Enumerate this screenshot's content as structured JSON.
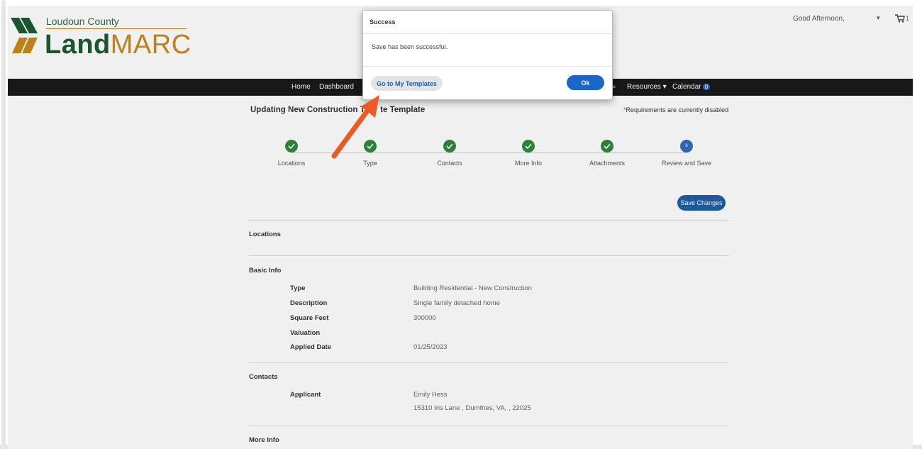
{
  "header": {
    "county": "Loudoun County",
    "brand_land": "Land",
    "brand_marc": "MARC",
    "greeting": "Good Afternoon,",
    "cart_count": "1"
  },
  "nav": {
    "items": [
      "Home",
      "Dashboard",
      "Resources ▾",
      "Calendar"
    ],
    "calendar_badge": "0"
  },
  "page": {
    "title": "Updating New Construction Te",
    "title_hidden_tail": "te Template",
    "requirements_star": "*",
    "requirements_note": "Requirements are currently disabled"
  },
  "stepper": {
    "steps": [
      {
        "label": "Locations",
        "status": "complete"
      },
      {
        "label": "Type",
        "status": "complete"
      },
      {
        "label": "Contacts",
        "status": "complete"
      },
      {
        "label": "More Info",
        "status": "complete"
      },
      {
        "label": "Attachments",
        "status": "complete"
      },
      {
        "label": "Review and Save",
        "status": "current",
        "number": "6"
      }
    ]
  },
  "actions": {
    "save_changes": "Save Changes"
  },
  "sections": {
    "locations": "Locations",
    "basic_info": "Basic Info",
    "contacts": "Contacts",
    "more_info": "More Info"
  },
  "basic_info": {
    "type_label": "Type",
    "type_value": "Building Residential - New Construction",
    "description_label": "Description",
    "description_value": "Single family detached home",
    "sqft_label": "Square Feet",
    "sqft_value": "300000",
    "valuation_label": "Valuation",
    "valuation_value": "",
    "applied_label": "Applied Date",
    "applied_value": "01/25/2023"
  },
  "contacts": {
    "applicant_label": "Applicant",
    "applicant_name": "Emily Hess",
    "applicant_address": "15310 Iris Lane , Dumfries, VA, , 22025"
  },
  "modal": {
    "title": "Success",
    "message": "Save has been successful.",
    "templates_button": "Go to My Templates",
    "ok_button": "Ok"
  },
  "colors": {
    "brand_green": "#1d5a33",
    "brand_gold": "#c98a1c",
    "step_complete": "#2e8b3d",
    "step_current": "#2e6fc0",
    "primary_button": "#1b66c9",
    "annotation_arrow": "#ee5a24"
  }
}
